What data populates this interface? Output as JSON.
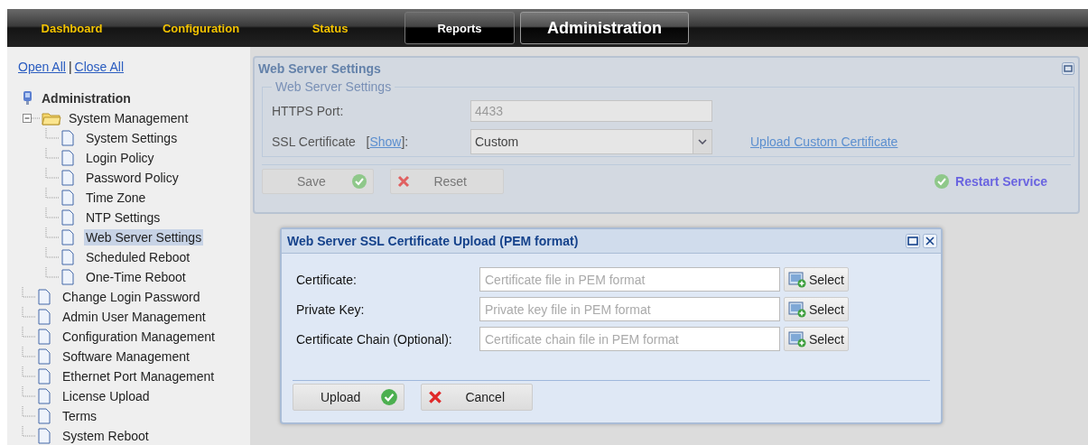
{
  "nav": {
    "tabs": [
      {
        "label": "Dashboard",
        "kind": "plain",
        "selected": false
      },
      {
        "label": "Configuration",
        "kind": "plain",
        "selected": false
      },
      {
        "label": "Status",
        "kind": "plain",
        "selected": false
      },
      {
        "label": "Reports",
        "kind": "boxed",
        "selected": false
      },
      {
        "label": "Administration",
        "kind": "boxed",
        "selected": true
      }
    ]
  },
  "sidebar": {
    "links": [
      "Open All",
      "Close All"
    ],
    "separator": "|",
    "tree": [
      {
        "label": "Administration",
        "kind": "root",
        "children": [
          {
            "label": "System Management",
            "kind": "folder",
            "expanded": true,
            "children": [
              {
                "label": "System Settings",
                "kind": "page",
                "selected": false
              },
              {
                "label": "Login Policy",
                "kind": "page",
                "selected": false
              },
              {
                "label": "Password Policy",
                "kind": "page",
                "selected": false
              },
              {
                "label": "Time Zone",
                "kind": "page",
                "selected": false
              },
              {
                "label": "NTP Settings",
                "kind": "page",
                "selected": false
              },
              {
                "label": "Web Server Settings",
                "kind": "page",
                "selected": true
              },
              {
                "label": "Scheduled Reboot",
                "kind": "page",
                "selected": false
              },
              {
                "label": "One-Time Reboot",
                "kind": "page",
                "selected": false
              }
            ]
          },
          {
            "label": "Change Login Password",
            "kind": "page",
            "selected": false
          },
          {
            "label": "Admin User Management",
            "kind": "page",
            "selected": false
          },
          {
            "label": "Configuration Management",
            "kind": "page",
            "selected": false
          },
          {
            "label": "Software Management",
            "kind": "page",
            "selected": false
          },
          {
            "label": "Ethernet Port Management",
            "kind": "page",
            "selected": false
          },
          {
            "label": "License Upload",
            "kind": "page",
            "selected": false
          },
          {
            "label": "Terms",
            "kind": "page",
            "selected": false
          },
          {
            "label": "System Reboot",
            "kind": "page",
            "selected": false
          }
        ]
      }
    ]
  },
  "panel": {
    "title": "Web Server Settings",
    "legend": "Web Server Settings",
    "https_port": {
      "label": "HTTPS Port:",
      "value": "4433",
      "disabled": true
    },
    "ssl_certificate": {
      "label": "SSL Certificate",
      "show_link": "Show",
      "bracket_open": "[",
      "bracket_close": "]:",
      "value": "Custom"
    },
    "upload_link": "Upload Custom Certificate",
    "buttons": [
      {
        "label": "Save",
        "kind": "ok"
      },
      {
        "label": "Reset",
        "kind": "cancel"
      }
    ],
    "restart": "Restart Service"
  },
  "dialog": {
    "title": "Web Server SSL Certificate Upload (PEM format)",
    "rows": [
      {
        "label": "Certificate:",
        "placeholder": "Certificate file in PEM format",
        "button": "Select"
      },
      {
        "label": "Private Key:",
        "placeholder": "Private key file in PEM format",
        "button": "Select"
      },
      {
        "label": "Certificate Chain (Optional):",
        "placeholder": "Certificate chain file in PEM format",
        "button": "Select"
      }
    ],
    "buttons": [
      {
        "label": "Upload",
        "kind": "ok"
      },
      {
        "label": "Cancel",
        "kind": "cancel"
      }
    ]
  }
}
